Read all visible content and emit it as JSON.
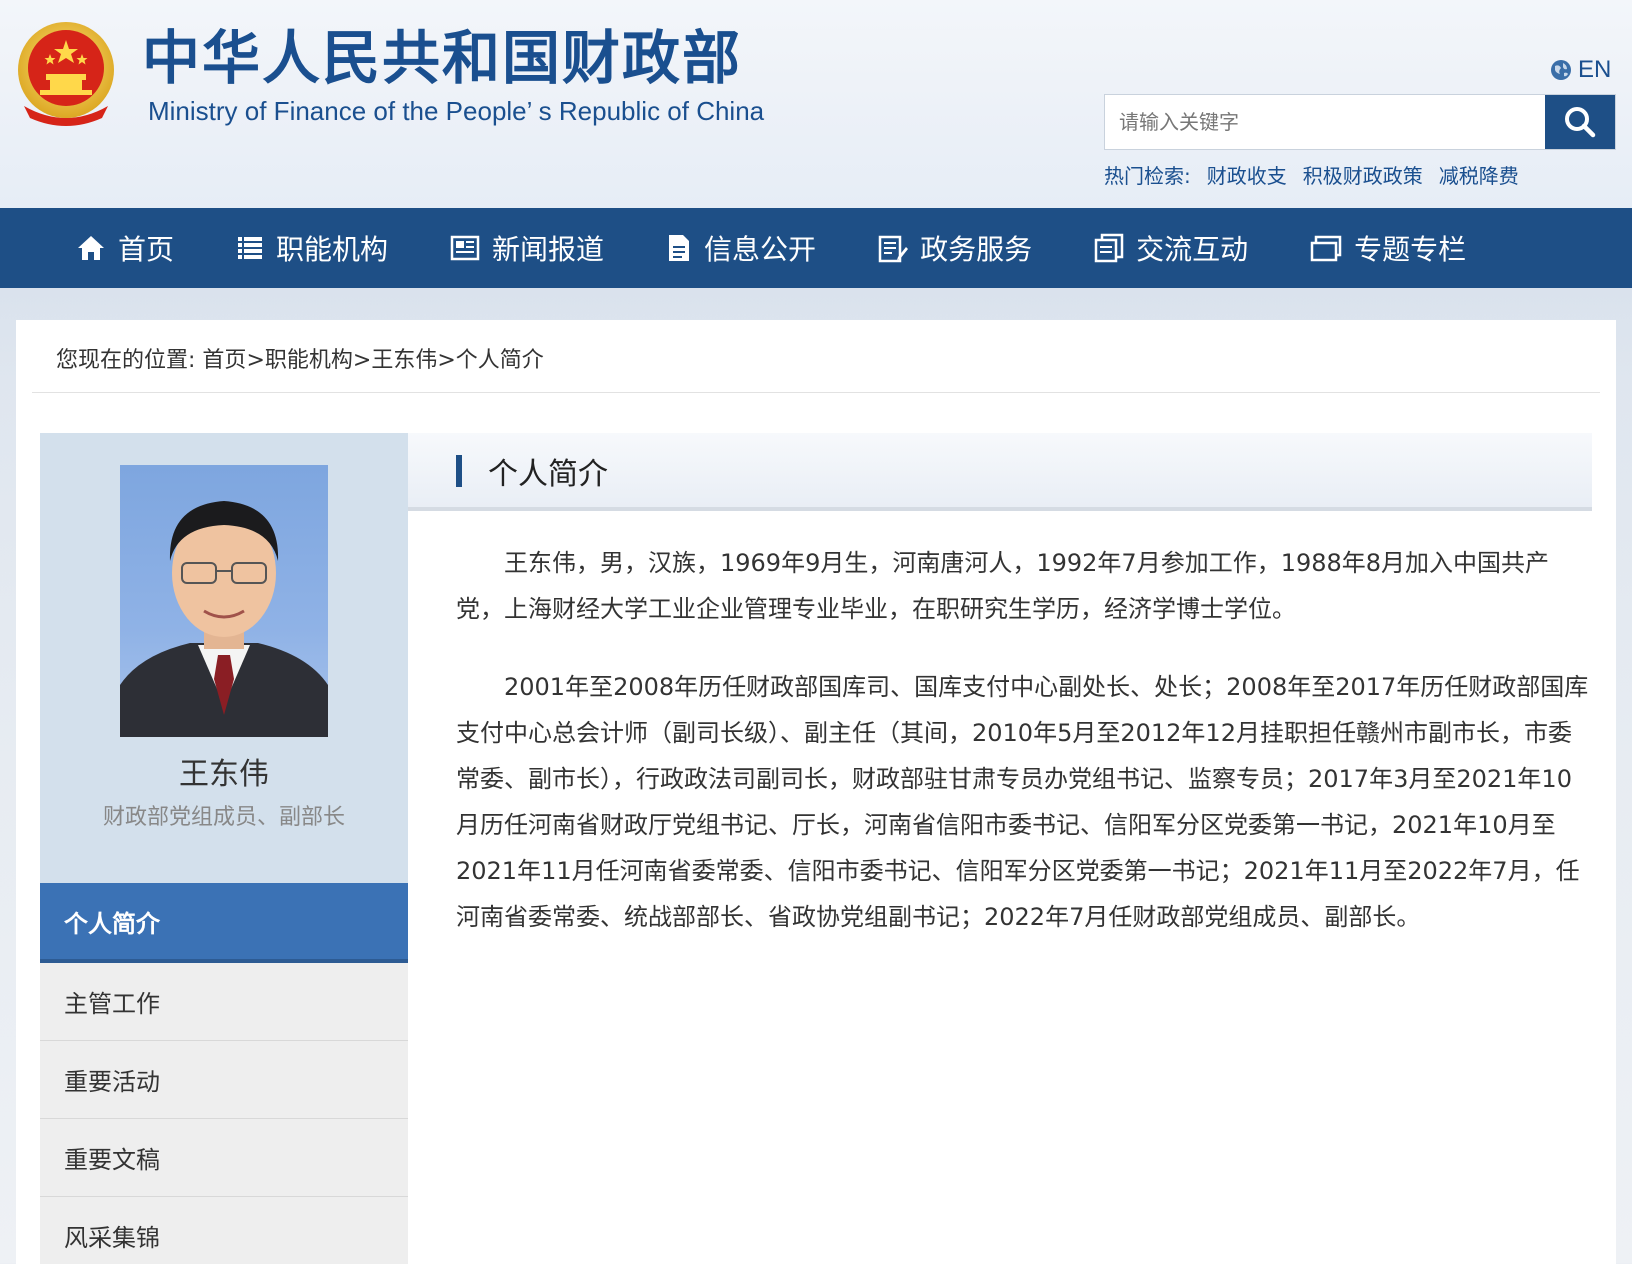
{
  "header": {
    "site_name_cn": "中华人民共和国财政部",
    "site_name_en": "Ministry of Finance of the People’ s Republic of China",
    "language_label": "EN",
    "search_placeholder": "请输入关键字",
    "hot_label": "热门检索:",
    "hot_links": [
      "财政收支",
      "积极财政政策",
      "减税降费"
    ]
  },
  "nav": {
    "items": [
      {
        "label": "首页",
        "icon": "home-icon"
      },
      {
        "label": "职能机构",
        "icon": "list-icon"
      },
      {
        "label": "新闻报道",
        "icon": "news-icon"
      },
      {
        "label": "信息公开",
        "icon": "document-icon"
      },
      {
        "label": "政务服务",
        "icon": "form-icon"
      },
      {
        "label": "交流互动",
        "icon": "chat-icon"
      },
      {
        "label": "专题专栏",
        "icon": "folder-icon"
      }
    ]
  },
  "breadcrumb": {
    "prefix": "您现在的位置:",
    "items": [
      "首页",
      "职能机构",
      "王东伟",
      "个人简介"
    ]
  },
  "profile": {
    "name": "王东伟",
    "title": "财政部党组成员、副部长"
  },
  "sidebar_menu": {
    "items": [
      "个人简介",
      "主管工作",
      "重要活动",
      "重要文稿",
      "风采集锦"
    ],
    "active_index": 0
  },
  "content": {
    "heading": "个人简介",
    "paragraphs": [
      "王东伟，男，汉族，1969年9月生，河南唐河人，1992年7月参加工作，1988年8月加入中国共产党，上海财经大学工业企业管理专业毕业，在职研究生学历，经济学博士学位。",
      "2001年至2008年历任财政部国库司、国库支付中心副处长、处长；2008年至2017年历任财政部国库支付中心总会计师（副司长级）、副主任（其间，2010年5月至2012年12月挂职担任赣州市副市长，市委常委、副市长），行政政法司副司长，财政部驻甘肃专员办党组书记、监察专员；2017年3月至2021年10月历任河南省财政厅党组书记、厅长，河南省信阳市委书记、信阳军分区党委第一书记，2021年10月至2021年11月任河南省委常委、信阳市委书记、信阳军分区党委第一书记；2021年11月至2022年7月，任河南省委常委、统战部部长、省政协党组副书记；2022年7月任财政部党组成员、副部长。"
    ]
  },
  "colors": {
    "primary": "#1e4f86",
    "active_menu": "#3b72b5",
    "sidebar_bg": "#d3e0ec"
  }
}
